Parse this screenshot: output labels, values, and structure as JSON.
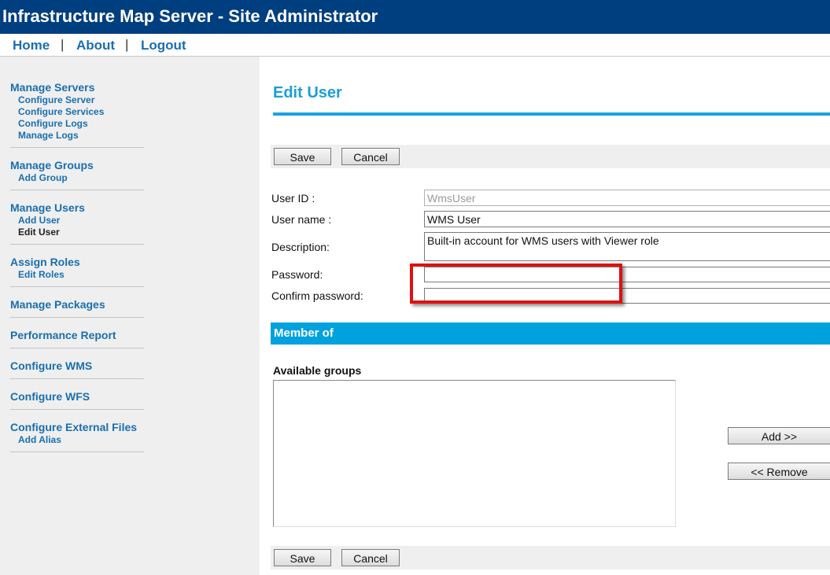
{
  "app": {
    "title": "Infrastructure Map Server - Site Administrator"
  },
  "nav": {
    "links": [
      "Home",
      "About",
      "Logout"
    ],
    "separator": "|"
  },
  "sidebar": {
    "groups": [
      {
        "heading": "Manage Servers",
        "items": [
          "Configure Server",
          "Configure Services",
          "Configure Logs",
          "Manage Logs"
        ]
      },
      {
        "heading": "Manage Groups",
        "items": [
          "Add Group"
        ]
      },
      {
        "heading": "Manage Users",
        "items": [
          "Add User",
          "Edit User"
        ],
        "active_item": "Edit User"
      },
      {
        "heading": "Assign Roles",
        "items": [
          "Edit Roles"
        ]
      },
      {
        "heading": "Manage Packages",
        "items": []
      },
      {
        "heading": "Performance Report",
        "items": []
      },
      {
        "heading": "Configure WMS",
        "items": []
      },
      {
        "heading": "Configure WFS",
        "items": []
      },
      {
        "heading": "Configure External Files",
        "items": [
          "Add Alias"
        ]
      }
    ]
  },
  "main": {
    "page_title": "Edit User",
    "buttons": {
      "save": "Save",
      "cancel": "Cancel"
    },
    "form": {
      "user_id_label": "User ID :",
      "user_id_value": "WmsUser",
      "user_name_label": "User name :",
      "user_name_value": "WMS User",
      "description_label": "Description:",
      "description_value": "Built-in account for WMS users with Viewer role",
      "password_label": "Password:",
      "password_value": "",
      "confirm_password_label": "Confirm password:",
      "confirm_password_value": ""
    },
    "member_of": {
      "section_title": "Member of",
      "available_groups_label": "Available groups",
      "available_groups": [],
      "add_button": "Add >>",
      "remove_button": "<< Remove"
    }
  },
  "colors": {
    "title_bar": "#003f7f",
    "link": "#1a6fb0",
    "accent": "#1ba3dd",
    "section_bar": "#00a2de",
    "highlight": "#dd1111",
    "sidebar_bg": "#efefef"
  }
}
